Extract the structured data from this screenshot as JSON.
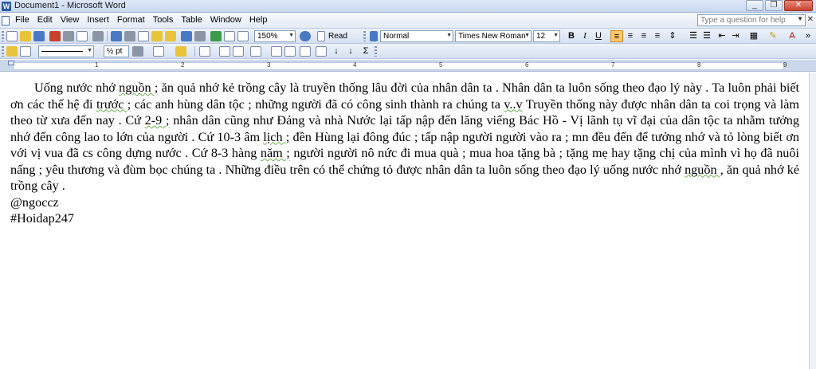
{
  "window": {
    "title": "Document1 - Microsoft Word"
  },
  "menu": {
    "items": [
      "File",
      "Edit",
      "View",
      "Insert",
      "Format",
      "Tools",
      "Table",
      "Window",
      "Help"
    ],
    "help_placeholder": "Type a question for help"
  },
  "toolbar": {
    "zoom": "150%",
    "read_label": "Read",
    "style": "Normal",
    "font": "Times New Roman",
    "size": "12",
    "bold": "B",
    "italic": "I",
    "underline": "U",
    "line_weight": "½ pt"
  },
  "document": {
    "para1_a": "Uống nước nhớ ",
    "para1_b": "nguồn ;",
    "para1_c": " ăn quả nhớ kẻ trồng cây là truyền thống lâu đời của nhân dân ta . Nhân dân ta luôn sống theo đạo lý này . Ta luôn phải biết ơn các thế hệ đi ",
    "para1_d": "trước ;",
    "para1_e": " các anh hùng dân tộc ; những người đã có công sinh thành ra chúng ta ",
    "para1_f": "v..v",
    "para1_g": " Truyền thống này được nhân dân ta coi trọng và làm theo từ xưa đến nay . Cứ ",
    "para1_h": "2-9 ;",
    "para1_i": " nhân dân cũng như Đảng và nhà Nước lại tấp nập đến lăng viếng Bác Hồ - Vị lãnh tụ vĩ đại của dân tộc ta nhằm tưởng nhớ đến công lao to lớn của người . Cứ 10-3 âm ",
    "para1_j": "lịch ;",
    "para1_k": " đền Hùng lại đông đúc ; tấp nập người người vào ra ; mn đều đến để tưởng nhớ và tỏ lòng biết ơn với vị vua đã cs công dựng nước . Cứ 8-3 hàng ",
    "para1_l": "năm ;",
    "para1_m": " người người nô nức đi mua quà ; mua hoa tặng bà ; tặng mẹ hay tặng chị của mình vì họ đã nuôi nấng ; yêu thương và đùm bọc chúng ta . Những điều trên có thể chứng tỏ được nhân dân ta luôn sống theo đạo lý uống nước nhớ ",
    "para1_n": "nguồn ,",
    "para1_o": " ăn quả nhớ kẻ trồng cây .",
    "line2": "@ngoccz",
    "line3": "#Hoidap247"
  },
  "ruler": {
    "numbers": [
      "1",
      "2",
      "3",
      "4",
      "5",
      "6",
      "7",
      "8",
      "9"
    ]
  }
}
